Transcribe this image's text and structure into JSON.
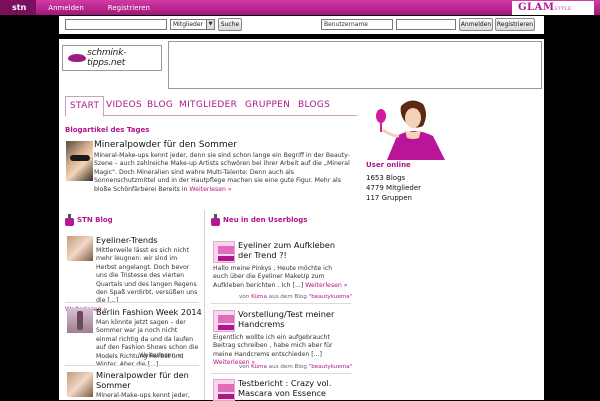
{
  "topbar": {
    "brand": "stn",
    "links": [
      "Anmelden",
      "Registrieren"
    ],
    "glam_logo": "GLAM",
    "glam_sub": "STYLE"
  },
  "search": {
    "select_value": "Mitglieder",
    "search_button": "Suche",
    "username_value": "Benutzername",
    "login_button": "Anmelden",
    "register_button": "Registrieren"
  },
  "header": {
    "logo_text": "schmink-tipps.net"
  },
  "nav": {
    "tabs": [
      "START",
      "VIDEOS",
      "BLOG",
      "MITGLIEDER",
      "GRUPPEN",
      "BLOGS"
    ]
  },
  "featured": {
    "heading": "Blogartikel des Tages",
    "title": "Mineralpowder für den Sommer",
    "text": "Mineral-Make-ups kennt jeder, denn sie sind schon lange ein Begriff in der Beauty-Szene – auch zahlreiche Make-up Artists schwören bei ihrer Arbeit auf die „Mineral Magic\". Doch Mineralien sind wahre Multi-Talente: Denn auch als Sonnenschutzmittel und in der Hautpflege machen sie eine gute Figur. Mehr als bloße Schönfärberei Bereits in",
    "more": "Weiterlesen »"
  },
  "stn_blog": {
    "heading": "STN Blog",
    "posts": [
      {
        "title": "Eyeliner-Trends",
        "text": "Mittlerweile lässt es sich nicht mehr leugnen: wir sind im Herbst angelangt. Doch bevor uns die Tristesse des vierten Quartals und des langen Regens den Spaß verdirbt, versüßen uns die [...]",
        "more": "Weiterlesen »"
      },
      {
        "title": "Berlin Fashion Week 2014",
        "text": "Man könnte jetzt sagen – der Sommer war ja noch nicht einmal richtig da und da laufen auf den Fashion Shows schon die Models Richtung Herbst und Winter. Aber die [...]",
        "more": "Weiterlesen »"
      },
      {
        "title": "Mineralpowder für den Sommer",
        "text": "Mineral-Make-ups kennt jeder,"
      }
    ]
  },
  "userblogs": {
    "heading": "Neu in den Userblogs",
    "posts": [
      {
        "title": "Eyeliner zum Aufkleben der Trend ?!",
        "text": "Hallo meine Pinkys , Heute möchte ich euch über die Eyeliner MakeUp zum Aufkleben berichten . Ich [...]",
        "more": "Weiterlesen »",
        "meta_prefix": "von",
        "author": "Küma",
        "meta_mid": "aus dem Blog",
        "blog": "\"beautykuema\""
      },
      {
        "title": "Vorstellung/Test meiner Handcrems",
        "text": "Eigentlich wollte ich ein aufgebraucht Beitrag schreiben , habe mich aber für meine Handcrems entschieden [...]",
        "more": "Weiterlesen »",
        "meta_prefix": "von",
        "author": "Küma",
        "meta_mid": "aus dem Blog",
        "blog": "\"beautykuema\""
      },
      {
        "title": "Testbericht : Crazy vol. Mascara von Essence"
      }
    ]
  },
  "sidebar": {
    "heading": "User online",
    "stats": [
      "1653 Blogs",
      "4779 Mitglieder",
      "117 Gruppen"
    ]
  }
}
